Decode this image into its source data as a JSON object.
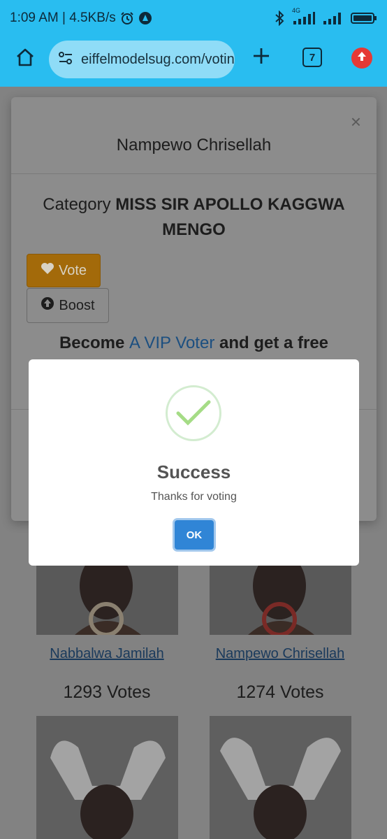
{
  "status_bar": {
    "time_speed": "1:09 AM | 4.5KB/s",
    "network_type": "4G",
    "icons": [
      "alarm-icon",
      "vpn-icon",
      "bluetooth-icon",
      "signal-icon",
      "signal-icon",
      "battery-icon"
    ]
  },
  "browser": {
    "url": "eiffelmodelsug.com/voting",
    "tab_count": "7",
    "icons": [
      "home-icon",
      "site-settings-icon",
      "plus-icon",
      "tabs-icon",
      "update-icon"
    ],
    "accent_color": "#29bdf0"
  },
  "modal": {
    "close": "×",
    "title": "Nampewo Chrisellah",
    "category_label": "Category",
    "category_value": "MISS SIR APOLLO KAGGWA MENGO",
    "vote_label": "Vote",
    "boost_label": "Boost",
    "vip_prefix": "Become",
    "vip_link": "A VIP Voter",
    "vip_suffix": "and get a free"
  },
  "contestants": [
    {
      "name": "Nabbalwa Jamilah",
      "votes": "1293 Votes"
    },
    {
      "name": "Nampewo Chrisellah",
      "votes": "1274 Votes"
    }
  ],
  "dialog": {
    "title": "Success",
    "text": "Thanks for voting",
    "ok_label": "OK",
    "success_color": "#a5dc86",
    "button_color": "#3085d6"
  }
}
